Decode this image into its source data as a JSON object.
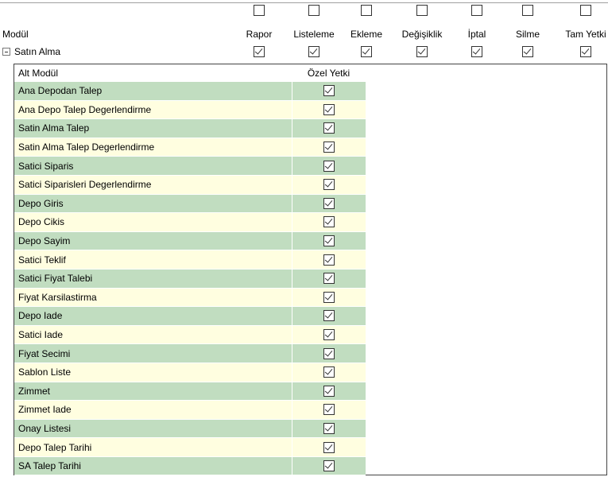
{
  "columns": [
    "Rapor",
    "Listeleme",
    "Ekleme",
    "Değişiklik",
    "İptal",
    "Silme",
    "Tam Yetki"
  ],
  "header": {
    "modul_label": "Modül"
  },
  "module": {
    "name": "Satın Alma",
    "expanded": true
  },
  "select_all_checked": [
    false,
    false,
    false,
    false,
    false,
    false,
    false
  ],
  "module_checked": [
    true,
    true,
    true,
    true,
    true,
    true,
    true
  ],
  "subtable": {
    "col_alt_modul": "Alt Modül",
    "col_ozel_yetki": "Özel Yetki",
    "row_colors": {
      "odd": "#c1ddc0",
      "even": "#fffee0"
    },
    "rows": [
      {
        "name": "Ana Depodan Talep",
        "checked": true
      },
      {
        "name": "Ana Depo Talep Degerlendirme",
        "checked": true
      },
      {
        "name": "Satin Alma Talep",
        "checked": true
      },
      {
        "name": "Satin Alma Talep Degerlendirme",
        "checked": true
      },
      {
        "name": "Satici Siparis",
        "checked": true
      },
      {
        "name": "Satici Siparisleri Degerlendirme",
        "checked": true
      },
      {
        "name": "Depo Giris",
        "checked": true
      },
      {
        "name": "Depo Cikis",
        "checked": true
      },
      {
        "name": "Depo Sayim",
        "checked": true
      },
      {
        "name": "Satici Teklif",
        "checked": true
      },
      {
        "name": "Satici Fiyat Talebi",
        "checked": true
      },
      {
        "name": "Fiyat Karsilastirma",
        "checked": true
      },
      {
        "name": "Depo Iade",
        "checked": true
      },
      {
        "name": "Satici Iade",
        "checked": true
      },
      {
        "name": "Fiyat Secimi",
        "checked": true
      },
      {
        "name": "Sablon Liste",
        "checked": true
      },
      {
        "name": "Zimmet",
        "checked": true
      },
      {
        "name": "Zimmet Iade",
        "checked": true
      },
      {
        "name": "Onay Listesi",
        "checked": true
      },
      {
        "name": "Depo Talep Tarihi",
        "checked": true
      },
      {
        "name": "SA Talep Tarihi",
        "checked": true
      }
    ]
  }
}
